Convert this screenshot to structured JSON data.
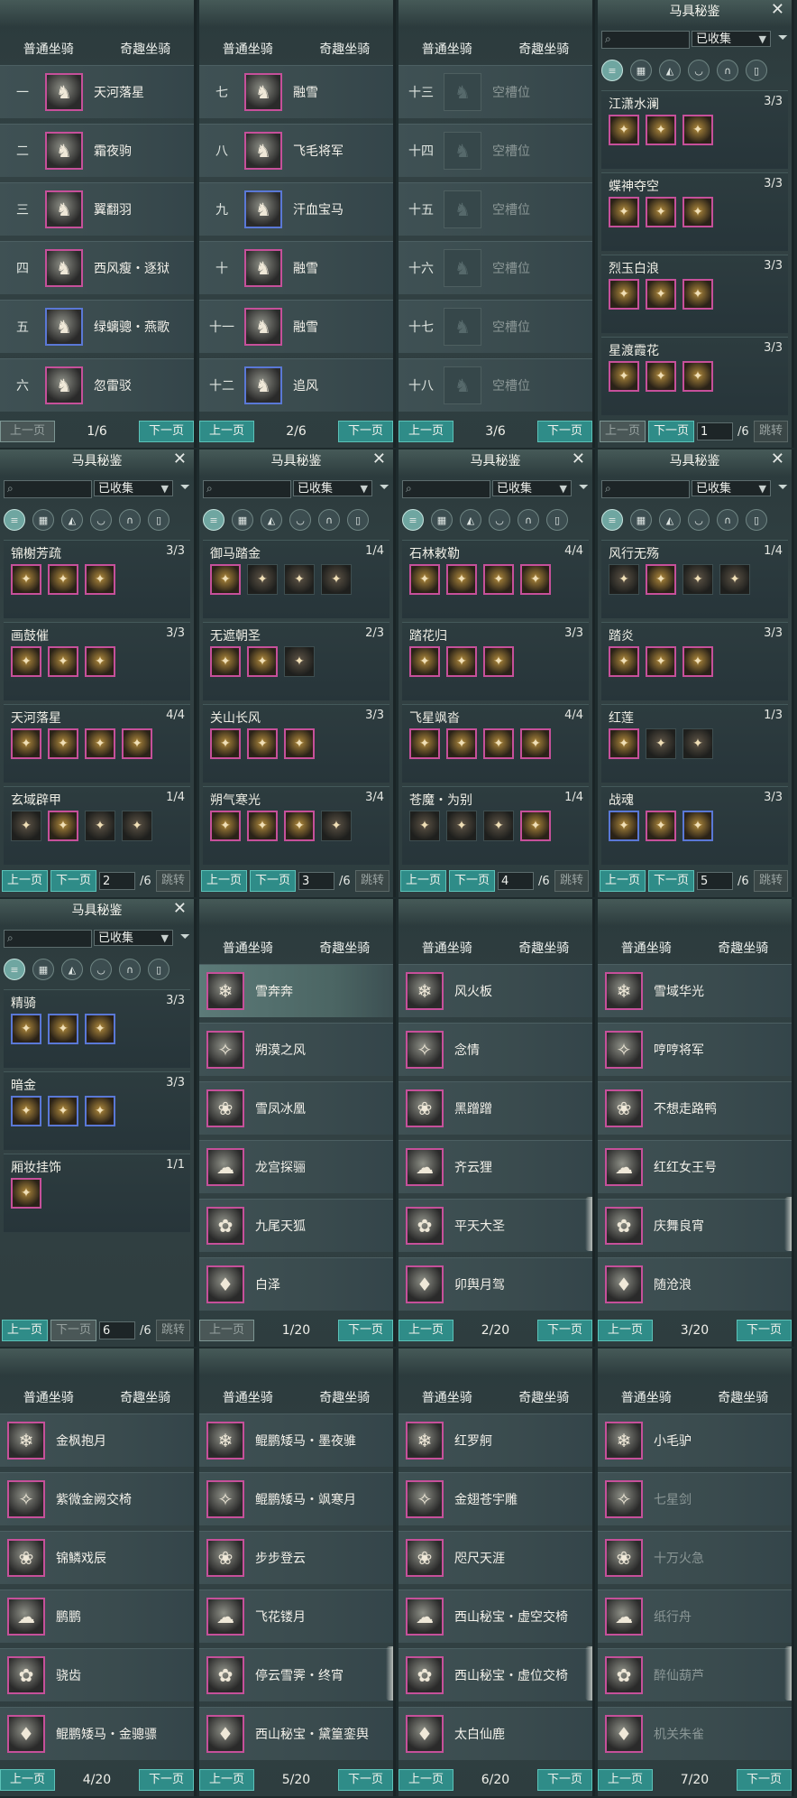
{
  "common": {
    "tab_normal": "普通坐骑",
    "tab_fun": "奇趣坐骑",
    "prev": "上一页",
    "next": "下一页",
    "catalog_title": "马具秘鉴",
    "filter_selected": "已收集",
    "jump": "跳转"
  },
  "mountPanels": [
    {
      "page": "1/6",
      "rows": [
        [
          "一",
          "天河落星",
          "m"
        ],
        [
          "二",
          "霜夜驹",
          "m"
        ],
        [
          "三",
          "翼翻羽",
          "m"
        ],
        [
          "四",
          "西风瘦・逐狱",
          "m"
        ],
        [
          "五",
          "绿螭骢・燕歌",
          "b"
        ],
        [
          "六",
          "忽雷驳",
          "m"
        ]
      ]
    },
    {
      "page": "2/6",
      "rows": [
        [
          "七",
          "融雪",
          "m"
        ],
        [
          "八",
          "飞毛将军",
          "m"
        ],
        [
          "九",
          "汗血宝马",
          "b"
        ],
        [
          "十",
          "融雪",
          "m"
        ],
        [
          "十一",
          "融雪",
          "m"
        ],
        [
          "十二",
          "追风",
          "b"
        ]
      ]
    },
    {
      "page": "3/6",
      "rows": [
        [
          "十三",
          "空槽位",
          "e"
        ],
        [
          "十四",
          "空槽位",
          "e"
        ],
        [
          "十五",
          "空槽位",
          "e"
        ],
        [
          "十六",
          "空槽位",
          "e"
        ],
        [
          "十七",
          "空槽位",
          "e"
        ],
        [
          "十八",
          "空槽位",
          "e"
        ]
      ]
    }
  ],
  "catalogPanels": [
    {
      "page": "1",
      "total": "/6",
      "sets": [
        [
          "江潇水澜",
          "3/3",
          [
            "m",
            "m",
            "m"
          ]
        ],
        [
          "蝶神夺空",
          "3/3",
          [
            "m",
            "m",
            "m"
          ]
        ],
        [
          "烈玉白浪",
          "3/3",
          [
            "m",
            "m",
            "m"
          ]
        ],
        [
          "星渡霞花",
          "3/3",
          [
            "m",
            "m",
            "m"
          ]
        ]
      ]
    },
    {
      "page": "2",
      "total": "/6",
      "sets": [
        [
          "锦榭芳疏",
          "3/3",
          [
            "m",
            "m",
            "m"
          ]
        ],
        [
          "画鼓催",
          "3/3",
          [
            "m",
            "m",
            "m"
          ]
        ],
        [
          "天河落星",
          "4/4",
          [
            "m",
            "m",
            "m",
            "m"
          ]
        ],
        [
          "玄域辟甲",
          "1/4",
          [
            "d",
            "m",
            "d",
            "d"
          ]
        ]
      ]
    },
    {
      "page": "3",
      "total": "/6",
      "sets": [
        [
          "御马踏金",
          "1/4",
          [
            "m",
            "d",
            "d",
            "d"
          ]
        ],
        [
          "无遮朝圣",
          "2/3",
          [
            "m",
            "m",
            "d"
          ]
        ],
        [
          "关山长风",
          "3/3",
          [
            "m",
            "m",
            "m"
          ]
        ],
        [
          "朔气寒光",
          "3/4",
          [
            "m",
            "m",
            "m",
            "d"
          ]
        ]
      ]
    },
    {
      "page": "4",
      "total": "/6",
      "sets": [
        [
          "石林敕勒",
          "4/4",
          [
            "m",
            "m",
            "m",
            "m"
          ]
        ],
        [
          "踏花归",
          "3/3",
          [
            "m",
            "m",
            "m"
          ]
        ],
        [
          "飞星飒沓",
          "4/4",
          [
            "m",
            "m",
            "m",
            "m"
          ]
        ],
        [
          "苍魔・为别",
          "1/4",
          [
            "d",
            "d",
            "d",
            "m"
          ]
        ]
      ]
    },
    {
      "page": "5",
      "total": "/6",
      "sets": [
        [
          "风行无殇",
          "1/4",
          [
            "d",
            "m",
            "d",
            "d"
          ]
        ],
        [
          "踏炎",
          "3/3",
          [
            "m",
            "m",
            "m"
          ]
        ],
        [
          "红莲",
          "1/3",
          [
            "m",
            "d",
            "d"
          ]
        ],
        [
          "战魂",
          "3/3",
          [
            "b",
            "m",
            "b"
          ]
        ]
      ]
    },
    {
      "page": "6",
      "total": "/6",
      "sets": [
        [
          "精骑",
          "3/3",
          [
            "b",
            "b",
            "b"
          ]
        ],
        [
          "暗金",
          "3/3",
          [
            "b",
            "b",
            "b"
          ]
        ],
        [
          "厢妆挂饰",
          "1/1",
          [
            "m"
          ]
        ]
      ]
    }
  ],
  "funPanels": [
    {
      "page": "1/20",
      "rows": [
        "雪奔奔",
        "朔漠之风",
        "雪凤冰凰",
        "龙宫探骊",
        "九尾天狐",
        "白泽"
      ]
    },
    {
      "page": "2/20",
      "rows": [
        "风火板",
        "念情",
        "黑蹭蹭",
        "齐云狸",
        "平天大圣",
        "卯舆月驾"
      ]
    },
    {
      "page": "3/20",
      "rows": [
        "雪域华光",
        "哼哼将军",
        "不想走路鸭",
        "红红女王号",
        "庆舞良宵",
        "随沧浪"
      ]
    },
    {
      "page": "4/20",
      "rows": [
        "金枫抱月",
        "紫微金阙交椅",
        "锦鳞戏辰",
        "鹏鹏",
        "骁齿",
        "鲲鹏矮马・金骢骠"
      ]
    },
    {
      "page": "5/20",
      "rows": [
        "鲲鹏矮马・墨夜骓",
        "鲲鹏矮马・飒寒月",
        "步步登云",
        "飞花镂月",
        "停云雪霁・终宵",
        "西山秘宝・黛篁銮舆"
      ]
    },
    {
      "page": "6/20",
      "rows": [
        "红罗舸",
        "金翅苍宇雕",
        "咫尺天涯",
        "西山秘宝・虚空交椅",
        "西山秘宝・虚位交椅",
        "太白仙鹿"
      ]
    },
    {
      "page": "7/20",
      "rows": [
        "小毛驴",
        "七星剑",
        "十万火急",
        "纸行舟",
        "醉仙葫芦",
        "机关朱雀"
      ]
    }
  ]
}
